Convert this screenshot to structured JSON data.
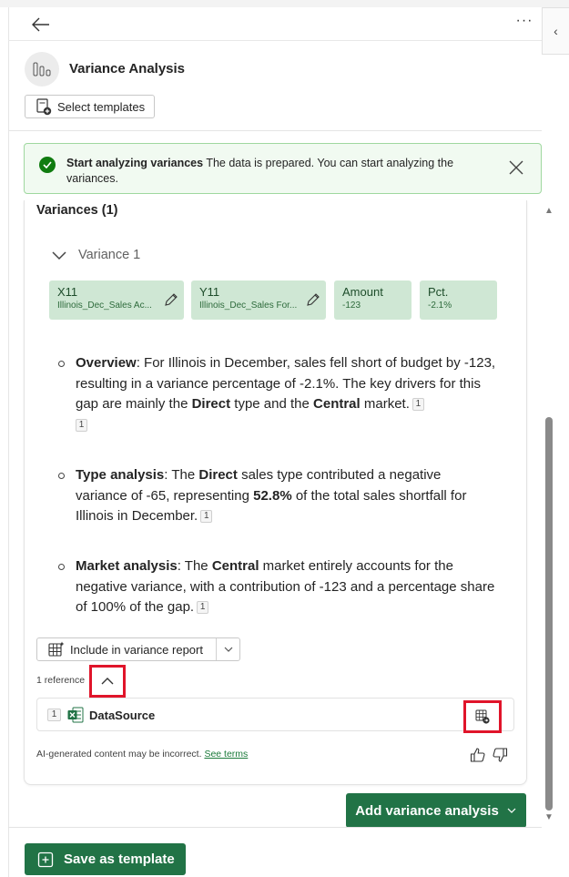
{
  "header": {
    "back_icon": "arrow-left-icon",
    "more_label": "···",
    "collapse_label": "‹"
  },
  "pane": {
    "icon": "bar-chart-icon",
    "title": "Variance Analysis",
    "select_templates_label": "Select templates"
  },
  "banner": {
    "title": "Start analyzing variances",
    "message": " The data is prepared. You can start analyzing the variances.",
    "status_color": "#107c10"
  },
  "variances": {
    "heading": "Variances (1)",
    "items": [
      {
        "label": "Variance 1",
        "chips": [
          {
            "key": "X11",
            "value": "Illinois_Dec_Sales Ac..."
          },
          {
            "key": "Y11",
            "value": "Illinois_Dec_Sales For..."
          },
          {
            "key": "Amount",
            "value": "-123"
          },
          {
            "key": "Pct.",
            "value": "-2.1%"
          }
        ]
      }
    ]
  },
  "analysis": {
    "overview": {
      "title": "Overview",
      "t1": ": For Illinois in December, sales fell short of budget by -123, resulting in a variance percentage of -2.1%. The key drivers for this gap are mainly the ",
      "b1": "Direct",
      "t2": " type and the ",
      "b2": "Central",
      "t3": " market.",
      "ref1": "1",
      "ref2": "1"
    },
    "type": {
      "title": "Type analysis",
      "t1": ": The ",
      "b1": "Direct",
      "t2": " sales type contributed a negative variance of -65, representing ",
      "b2": "52.8%",
      "t3": " of the total sales shortfall for Illinois in December.",
      "ref1": "1"
    },
    "market": {
      "title": "Market analysis",
      "t1": ": The ",
      "b1": "Central",
      "t2": " market entirely accounts for the negative variance, with a contribution of -123 and a percentage share of 100% of the gap.",
      "ref1": "1"
    }
  },
  "actions": {
    "include_label": "Include in variance report",
    "references_label": "1 reference",
    "source": {
      "num": "1",
      "name": "DataSource"
    },
    "disclaimer": "AI-generated content may be incorrect.",
    "terms_label": "See terms",
    "add_label": "Add variance analysis",
    "save_label": "Save as template",
    "brand_color": "#217346",
    "highlight_color": "#e0142a"
  }
}
